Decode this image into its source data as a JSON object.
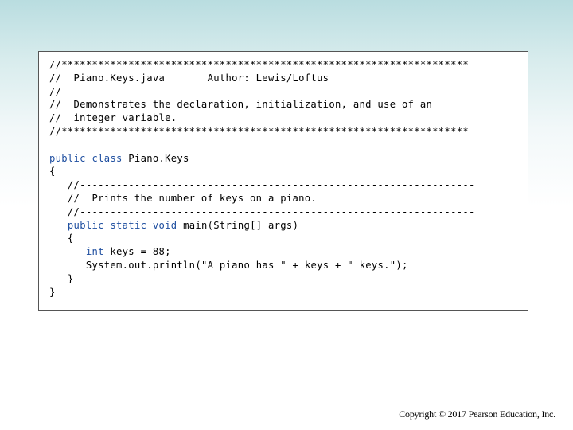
{
  "code": {
    "lines": [
      "//*******************************************************************",
      "//  Piano.Keys.java       Author: Lewis/Loftus",
      "//",
      "//  Demonstrates the declaration, initialization, and use of an",
      "//  integer variable.",
      "//*******************************************************************",
      "",
      "public class Piano.Keys",
      "{",
      "   //-----------------------------------------------------------------",
      "   //  Prints the number of keys on a piano.",
      "   //-----------------------------------------------------------------",
      "   public static void main(String[] args)",
      "   {",
      "      int keys = 88;",
      "      System.out.println(\"A piano has \" + keys + \" keys.\");",
      "   }",
      "}"
    ],
    "keywords": [
      "public",
      "class",
      "static",
      "void",
      "int"
    ],
    "keyword_color": "#1f4fa0"
  },
  "footer": {
    "copyright": "Copyright © 2017 Pearson Education, Inc."
  }
}
